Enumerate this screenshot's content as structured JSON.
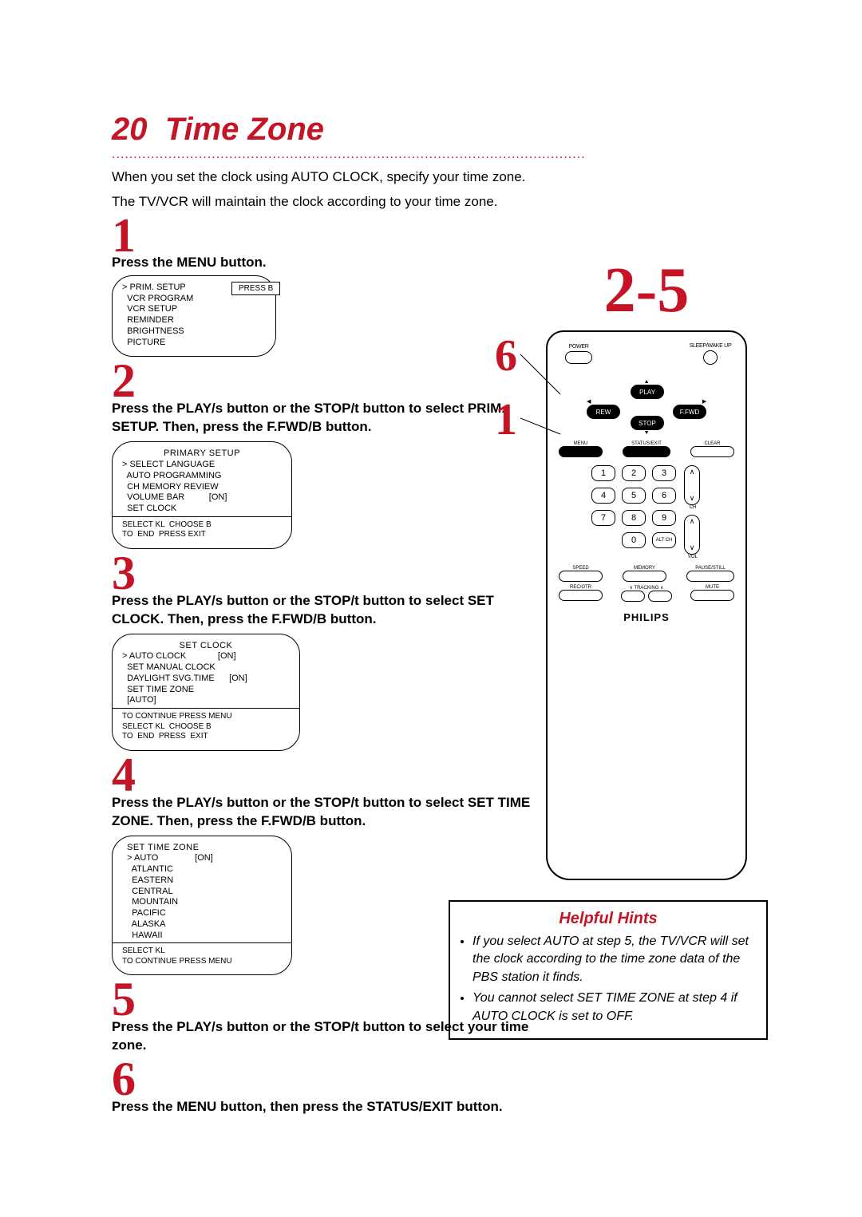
{
  "header": {
    "page_number": "20",
    "title": "Time Zone",
    "intro1": "When you set the clock using AUTO CLOCK, specify your time zone.",
    "intro2": "The TV/VCR will maintain the clock according to your time zone."
  },
  "callouts": {
    "n1": "1",
    "n2": "2",
    "n3": "3",
    "n4": "4",
    "n5": "5",
    "n6": "6",
    "range": "2-5"
  },
  "step1": {
    "text": "Press the MENU button.",
    "osd": {
      "items": [
        "> PRIM. SETUP",
        "  VCR PROGRAM",
        "  VCR SETUP",
        "  REMINDER",
        "  BRIGHTNESS",
        "  PICTURE"
      ],
      "balloon": "PRESS B"
    }
  },
  "step2": {
    "text": "Press the PLAY/s  button or the STOP/t  button to select PRIM. SETUP.  Then, press the F.FWD/B  button.",
    "osd": {
      "hdr": "PRIMARY SETUP",
      "items": [
        "> SELECT LANGUAGE",
        "  AUTO PROGRAMMING",
        "  CH MEMORY REVIEW",
        "  VOLUME BAR          [ON]",
        "  SET CLOCK"
      ],
      "foot": "SELECT KL  CHOOSE B\nTO  END  PRESS EXIT"
    }
  },
  "step3": {
    "text": "Press the PLAY/s  button or the STOP/t  button to select SET CLOCK. Then, press the F.FWD/B  button.",
    "osd": {
      "hdr": "SET CLOCK",
      "items": [
        "> AUTO CLOCK             [ON]",
        "  SET MANUAL CLOCK",
        "  DAYLIGHT SVG.TIME      [ON]",
        "  SET TIME ZONE",
        "  [AUTO]"
      ],
      "foot": "TO CONTINUE PRESS MENU\nSELECT KL  CHOOSE B\nTO  END  PRESS  EXIT"
    }
  },
  "step4": {
    "text": "Press the PLAY/s  button or the STOP/t  button to select SET TIME ZONE. Then, press the F.FWD/B  button.",
    "osd": {
      "hdr": "SET TIME ZONE",
      "items": [
        "  > AUTO               [ON]",
        "    ATLANTIC",
        "    EASTERN",
        "    CENTRAL",
        "    MOUNTAIN",
        "    PACIFIC",
        "    ALASKA",
        "    HAWAII"
      ],
      "foot": "SELECT KL\nTO CONTINUE PRESS MENU"
    }
  },
  "step5": {
    "text": "Press the PLAY/s  button or the STOP/t  button to select your time zone."
  },
  "step6": {
    "text": "Press the MENU button, then press the STATUS/EXIT button."
  },
  "remote": {
    "labels": {
      "power": "POWER",
      "sleep": "SLEEP/WAKE UP",
      "play": "PLAY",
      "rew": "REW",
      "ffwd": "F.FWD",
      "stop": "STOP",
      "menu": "MENU",
      "status": "STATUS/EXIT",
      "clear": "CLEAR",
      "altch": "ALT CH",
      "ch": "CH",
      "vol": "VOL",
      "speed": "SPEED",
      "memory": "MEMORY",
      "pause": "PAUSE/STILL",
      "recotr": "REC/OTR",
      "tracking": "∨  TRACKING  ∧",
      "mute": "MUTE"
    },
    "brand": "PHILIPS",
    "keys": [
      "1",
      "2",
      "3",
      "4",
      "5",
      "6",
      "7",
      "8",
      "9",
      "0"
    ]
  },
  "hints": {
    "title": "Helpful Hints",
    "b1": "If you select AUTO at step 5, the TV/VCR will set the clock according to the time zone data of the PBS station it finds.",
    "b2": "You cannot select SET TIME ZONE at step 4 if AUTO CLOCK is set to OFF."
  }
}
